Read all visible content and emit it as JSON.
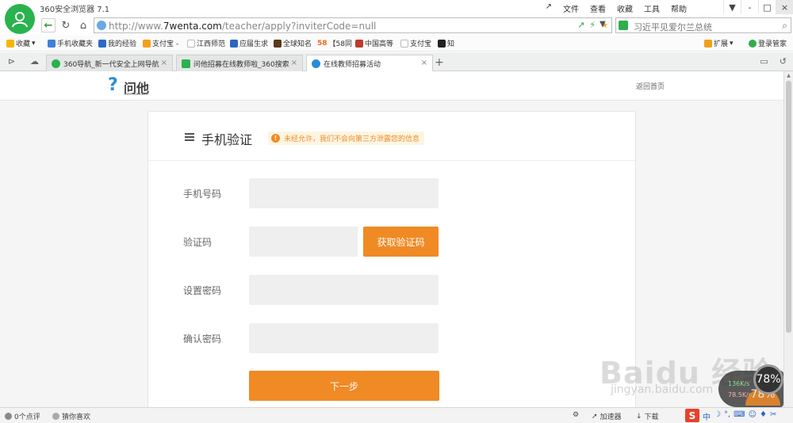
{
  "window": {
    "app_title": "360安全浏览器 7.1",
    "menu": [
      "文件",
      "查看",
      "收藏",
      "工具",
      "帮助"
    ],
    "controls": [
      "-",
      "□",
      "×"
    ]
  },
  "address_bar": {
    "url_base": "http://www.",
    "url_domain": "7wenta.com",
    "url_path": "/teacher/apply?inviterCode=null",
    "search_text": "习近平见爱尔兰总统"
  },
  "bookmarks": {
    "items": [
      {
        "label": "收藏",
        "color": "#f2b705"
      },
      {
        "label": "手机收藏夹",
        "color": "#3f7fd6"
      },
      {
        "label": "我的经验",
        "color": "#2e6ac8"
      },
      {
        "label": "支付宝 -",
        "color": "#f0a11b"
      },
      {
        "label": "江西师范",
        "color": "#bbbbbb"
      },
      {
        "label": "应届生求",
        "color": "#2d66c2"
      },
      {
        "label": "全球知名",
        "color": "#5a3a1a"
      },
      {
        "label": "【58同",
        "color": "#f26a1b"
      },
      {
        "label": "中国高等",
        "color": "#c0392b"
      },
      {
        "label": "支付宝",
        "color": "#bbbbbb"
      },
      {
        "label": "知",
        "color": "#222222"
      }
    ],
    "extensions_label": "扩展",
    "login_label": "登录管家"
  },
  "tabs": [
    {
      "label": "360导航_新一代安全上网导航",
      "icon_color": "#2ab24f"
    },
    {
      "label": "问他招募在线教师啦_360搜索",
      "icon_color": "#2ab24f"
    },
    {
      "label": "在线教师招募活动",
      "icon_color": "#2a8dd4"
    }
  ],
  "site": {
    "logo_name": "问他",
    "logo_domain": "7wenta.com",
    "back_home": "返回首页"
  },
  "form": {
    "title": "手机验证",
    "notice": "未经允许，我们不会向第三方泄露您的信息",
    "phone_label": "手机号码",
    "code_label": "验证码",
    "get_code_button": "获取验证码",
    "password_label": "设置密码",
    "confirm_label": "确认密码",
    "next_button": "下一步",
    "phone_value": "",
    "code_value": "",
    "password_value": "",
    "confirm_value": ""
  },
  "overlay": {
    "watermark": "Baidu 经验",
    "watermark_sub": "jingyan.baidu.com",
    "speed_up": "136K/s",
    "speed_down": "78.5K/s",
    "gauge_value": "78%"
  },
  "statusbar": {
    "reviews": "0个点评",
    "guess": "猜你喜欢",
    "accelerator": "加速器",
    "download": "下载",
    "ime_label": "S",
    "ime_lang": "中"
  },
  "colors": {
    "accent": "#f08a24",
    "brand_green": "#2ab24f",
    "logo_blue": "#2a8dd4"
  }
}
